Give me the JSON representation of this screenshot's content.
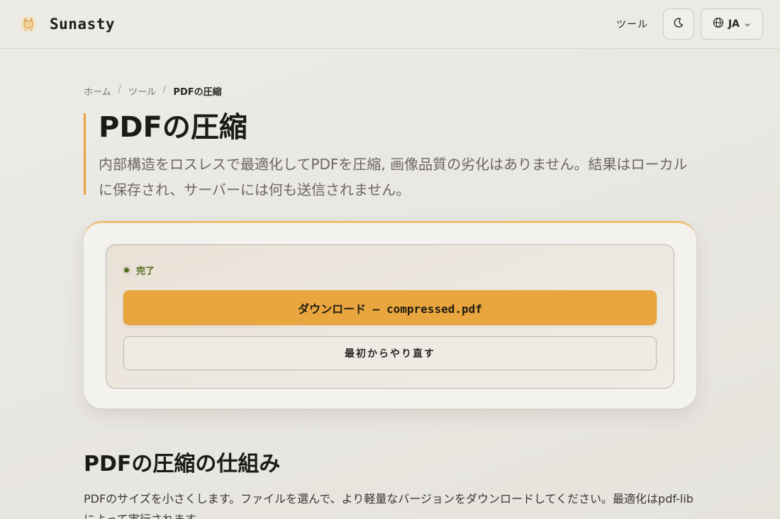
{
  "header": {
    "brand": "Sunasty",
    "nav_tools": "ツール",
    "theme_icon": "moon-icon",
    "language": "JA",
    "language_icon": "globe-icon"
  },
  "breadcrumb": {
    "home": "ホーム",
    "tools": "ツール",
    "current": "PDFの圧縮",
    "separator": "/"
  },
  "hero": {
    "title": "PDFの圧縮",
    "description": "内部構造をロスレスで最適化してPDFを圧縮, 画像品質の劣化はありません。結果はローカルに保存され、サーバーには何も送信されません。"
  },
  "result": {
    "status": "完了",
    "status_color": "#556b1e",
    "download_label": "ダウンロード — compressed.pdf",
    "restart_label": "最初からやり直す"
  },
  "how_it_works": {
    "title": "PDFの圧縮の仕組み",
    "body": "PDFのサイズを小さくします。ファイルを選んで、より軽量なバージョンをダウンロードしてください。最適化はpdf-libによって実行されます。"
  },
  "colors": {
    "accent": "#e9a63f",
    "background": "#ebe9e4"
  }
}
